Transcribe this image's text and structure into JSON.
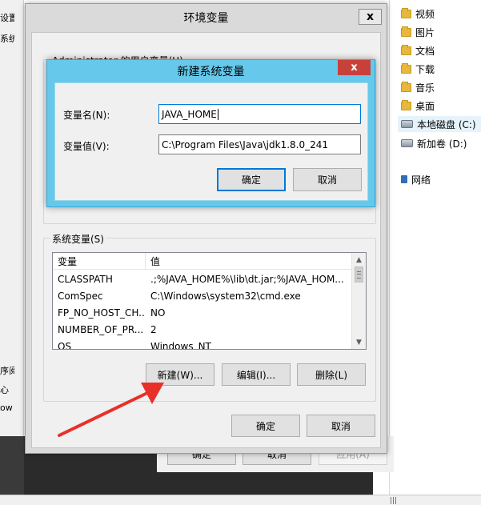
{
  "background_left": {
    "fragments": [
      "设置",
      "系统",
      "序阅",
      "心",
      "ow"
    ]
  },
  "background_bottom": {
    "ok_label": "确定",
    "cancel_label": "取消",
    "apply_label": "应用(A)"
  },
  "explorer": {
    "items": [
      {
        "label": "视频",
        "icon": "folder-icon"
      },
      {
        "label": "图片",
        "icon": "folder-icon"
      },
      {
        "label": "文档",
        "icon": "folder-icon"
      },
      {
        "label": "下载",
        "icon": "folder-icon"
      },
      {
        "label": "音乐",
        "icon": "folder-icon"
      },
      {
        "label": "桌面",
        "icon": "folder-icon"
      },
      {
        "label": "本地磁盘 (C:)",
        "icon": "drive-icon"
      },
      {
        "label": "新加卷 (D:)",
        "icon": "drive-icon"
      },
      {
        "label": "网络",
        "icon": "network-icon"
      }
    ]
  },
  "env_dialog": {
    "title": "环境变量",
    "close_glyph": "x",
    "user_group_label": "Administrator 的用户变量(U)",
    "system_group_label": "系统变量(S)",
    "list": {
      "columns": [
        "变量",
        "值"
      ],
      "rows": [
        [
          "CLASSPATH",
          ".;%JAVA_HOME%\\lib\\dt.jar;%JAVA_HOM..."
        ],
        [
          "ComSpec",
          "C:\\Windows\\system32\\cmd.exe"
        ],
        [
          "FP_NO_HOST_CH...",
          "NO"
        ],
        [
          "NUMBER_OF_PR...",
          "2"
        ],
        [
          "OS",
          "Windows_NT"
        ]
      ]
    },
    "new_label": "新建(W)...",
    "edit_label": "编辑(I)...",
    "delete_label": "删除(L)",
    "ok_label": "确定",
    "cancel_label": "取消"
  },
  "new_var_dialog": {
    "title": "新建系统变量",
    "close_glyph": "x",
    "name_label": "变量名(N):",
    "name_value": "JAVA_HOME",
    "value_label": "变量值(V):",
    "value_value": "C:\\Program Files\\Java\\jdk1.8.0_241",
    "ok_label": "确定",
    "cancel_label": "取消"
  },
  "colors": {
    "dialog_accent": "#66c8ea",
    "close_red": "#c7413b",
    "annotation_arrow": "#e8302a"
  }
}
